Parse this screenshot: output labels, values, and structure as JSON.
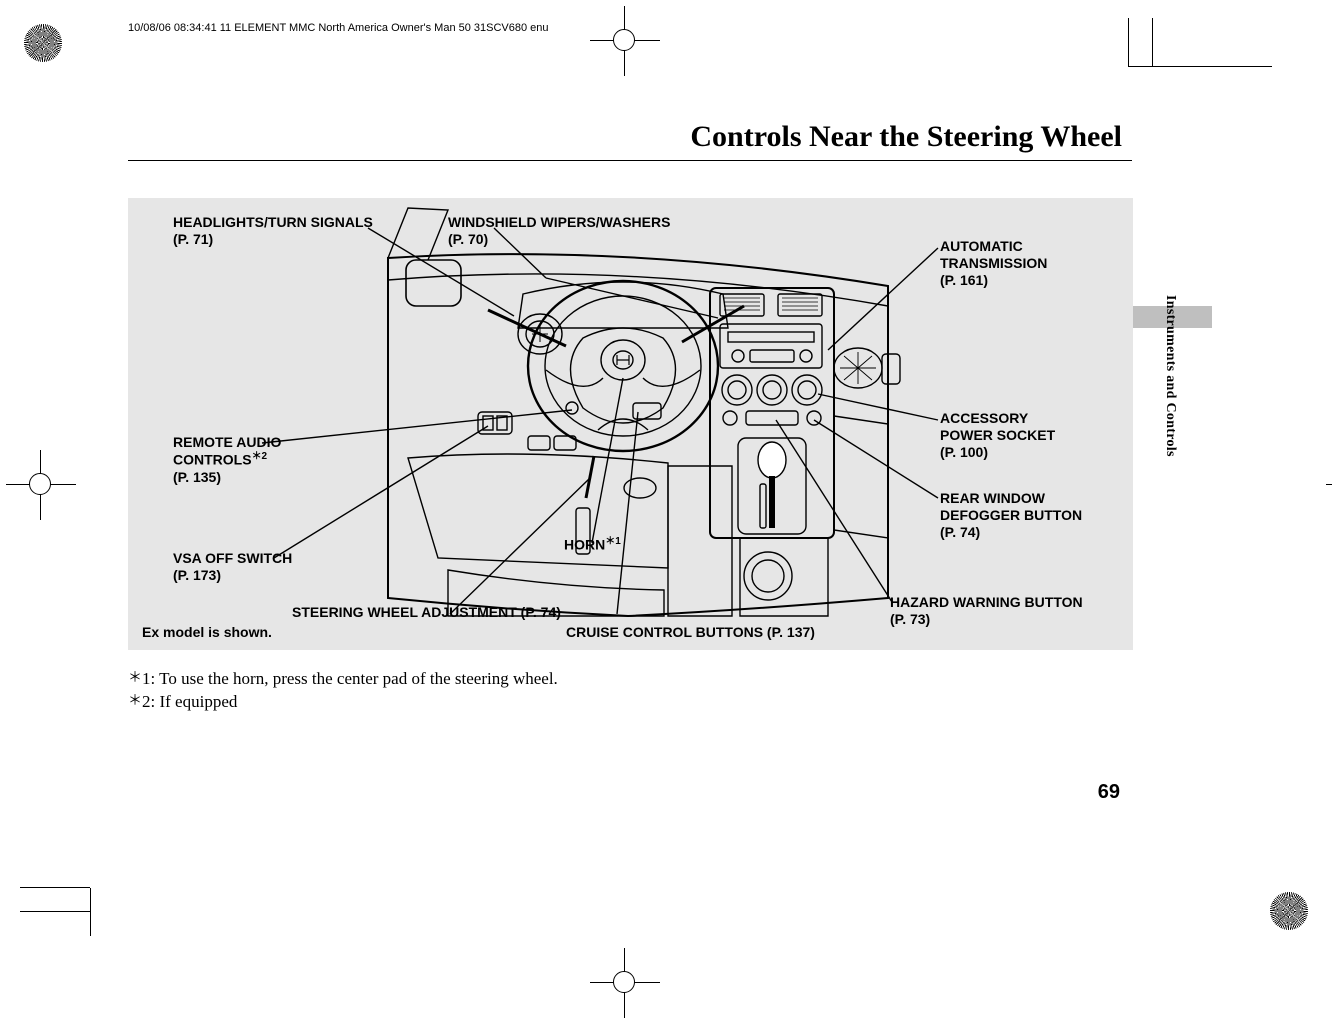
{
  "meta": {
    "header": "10/08/06 08:34:41    11 ELEMENT MMC North America Owner's Man 50 31SCV680 enu"
  },
  "title": "Controls Near the Steering Wheel",
  "sideTab": "Instruments and Controls",
  "callouts": {
    "headlights": {
      "l1": "HEADLIGHTS/TURN SIGNALS",
      "l2": "(P. 71)"
    },
    "wipers": {
      "l1": "WINDSHIELD WIPERS/WASHERS",
      "l2": "(P. 70)"
    },
    "autoTrans": {
      "l1": "AUTOMATIC",
      "l2": "TRANSMISSION",
      "l3": "(P. 161)"
    },
    "remoteAudio": {
      "l1": "REMOTE AUDIO",
      "l2": "CONTROLS",
      "sup": "＊2",
      "l3": "(P. 135)"
    },
    "vsaOff": {
      "l1": "VSA OFF SWITCH",
      "l2": "(P. 173)"
    },
    "horn": {
      "l1": "HORN",
      "sup": "＊1"
    },
    "steeringAdj": {
      "l1": "STEERING WHEEL ADJUSTMENT (P. 74)"
    },
    "accessory": {
      "l1": "ACCESSORY",
      "l2": "POWER SOCKET",
      "l3": "(P. 100)"
    },
    "rearDefog": {
      "l1": "REAR WINDOW",
      "l2": "DEFOGGER BUTTON",
      "l3": "(P. 74)"
    },
    "hazard": {
      "l1": "HAZARD WARNING BUTTON",
      "l2": "(P. 73)"
    },
    "cruise": "CRUISE CONTROL BUTTONS (P. 137)",
    "exNote": "Ex model is shown."
  },
  "footnotes": {
    "f1": "1: To use the horn, press the center pad of the steering wheel.",
    "f2": "2: If equipped",
    "ast": "＊"
  },
  "pageNumber": "69"
}
